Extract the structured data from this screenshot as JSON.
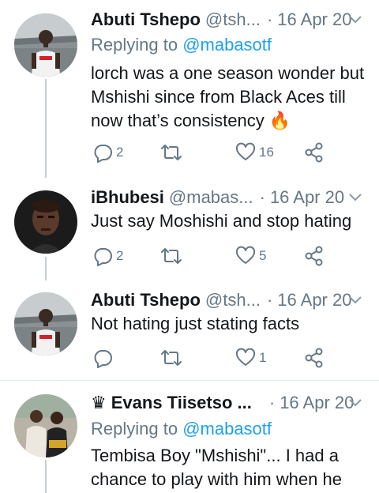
{
  "tweets": [
    {
      "name": "Abuti Tshepo",
      "handle": "@tsh...",
      "date": "16 Apr 20",
      "replying_prefix": "Replying to ",
      "replying_to": "@mabasotf",
      "text": "lorch was a one season wonder but Mshishi since from Black Aces till now that’s consistency 🔥",
      "replies": "2",
      "retweets": "",
      "likes": "16"
    },
    {
      "name": "iBhubesi",
      "handle": "@mabas...",
      "date": "16 Apr 20",
      "text": "Just say Moshishi and stop hating",
      "replies": "2",
      "retweets": "",
      "likes": "5"
    },
    {
      "name": "Abuti Tshepo",
      "handle": "@tsh...",
      "date": "16 Apr 20",
      "text": "Not hating just stating facts",
      "replies": "",
      "retweets": "",
      "likes": "1"
    },
    {
      "name_prefix": "♛",
      "name": "Evans Tiisetso ...",
      "handle": "",
      "date": "16 Apr 20",
      "replying_prefix": "Replying to ",
      "replying_to": "@mabasotf",
      "text": "Tembisa Boy \"Mshishi\"... I had a chance to play with him when he"
    }
  ],
  "icons": {
    "reply": "reply-icon",
    "retweet": "retweet-icon",
    "like": "heart-icon",
    "share": "share-icon",
    "more": "chevron-down-icon"
  },
  "colors": {
    "primary_text": "#14171a",
    "secondary_text": "#657786",
    "accent": "#1da1f2",
    "thread_line": "#c4cfd6",
    "divider": "#e1e8ed"
  }
}
